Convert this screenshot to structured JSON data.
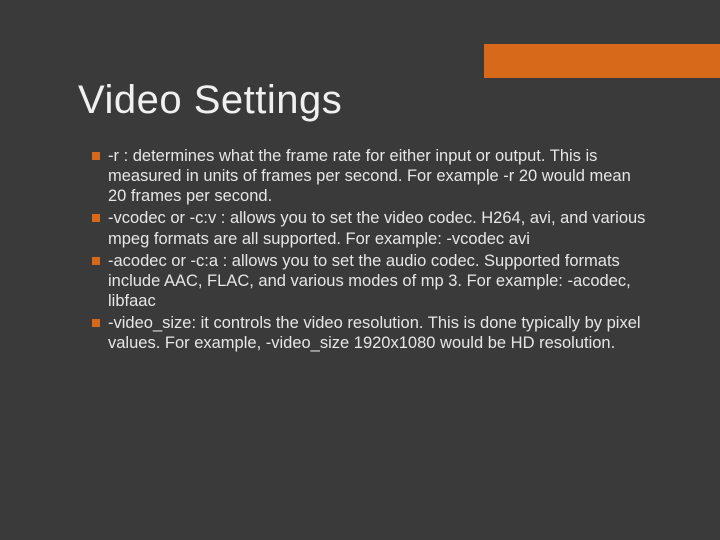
{
  "title": "Video Settings",
  "bullets": [
    "-r : determines what the frame rate for either input or output. This is measured in units of frames per second. For example -r 20 would mean 20 frames per second.",
    "-vcodec or -c:v : allows you to set the video codec. H264, avi, and various mpeg formats are all supported. For example: -vcodec avi",
    "-acodec or -c:a : allows you to set the audio codec. Supported formats include AAC, FLAC, and various modes of mp 3. For example: -acodec, libfaac",
    "-video_size: it controls the video resolution. This is done typically by pixel values. For example, -video_size 1920x1080 would be HD resolution."
  ]
}
